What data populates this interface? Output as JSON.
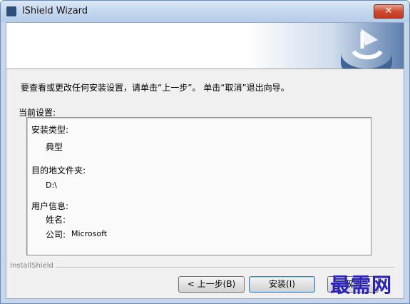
{
  "window": {
    "title": "lShield Wizard",
    "close_glyph": "✕"
  },
  "content": {
    "instruction": "要查看或更改任何安装设置，请单击“上一步”。 单击“取消”退出向导。",
    "settings_caption": "当前设置:",
    "settings": {
      "setup_type_label": "安装类型:",
      "setup_type_value": "典型",
      "dest_folder_label": "目的地文件夹:",
      "dest_folder_value": "D:\\",
      "user_info_label": "用户信息:",
      "name_label": "姓名:",
      "company_label": "公司:",
      "company_value": "Microsoft"
    }
  },
  "footer": {
    "brand": "InstallShield",
    "back_label": "< 上一步(B)",
    "install_label": "安装(I)",
    "cancel_label": "取消"
  },
  "watermark": "最需网",
  "colors": {
    "title_bar": "#c2d6ee",
    "close_button": "#cf4b31",
    "watermark": "#2a22b4"
  },
  "icons": {
    "app": "app-icon",
    "banner": "installshield-logo-icon"
  }
}
